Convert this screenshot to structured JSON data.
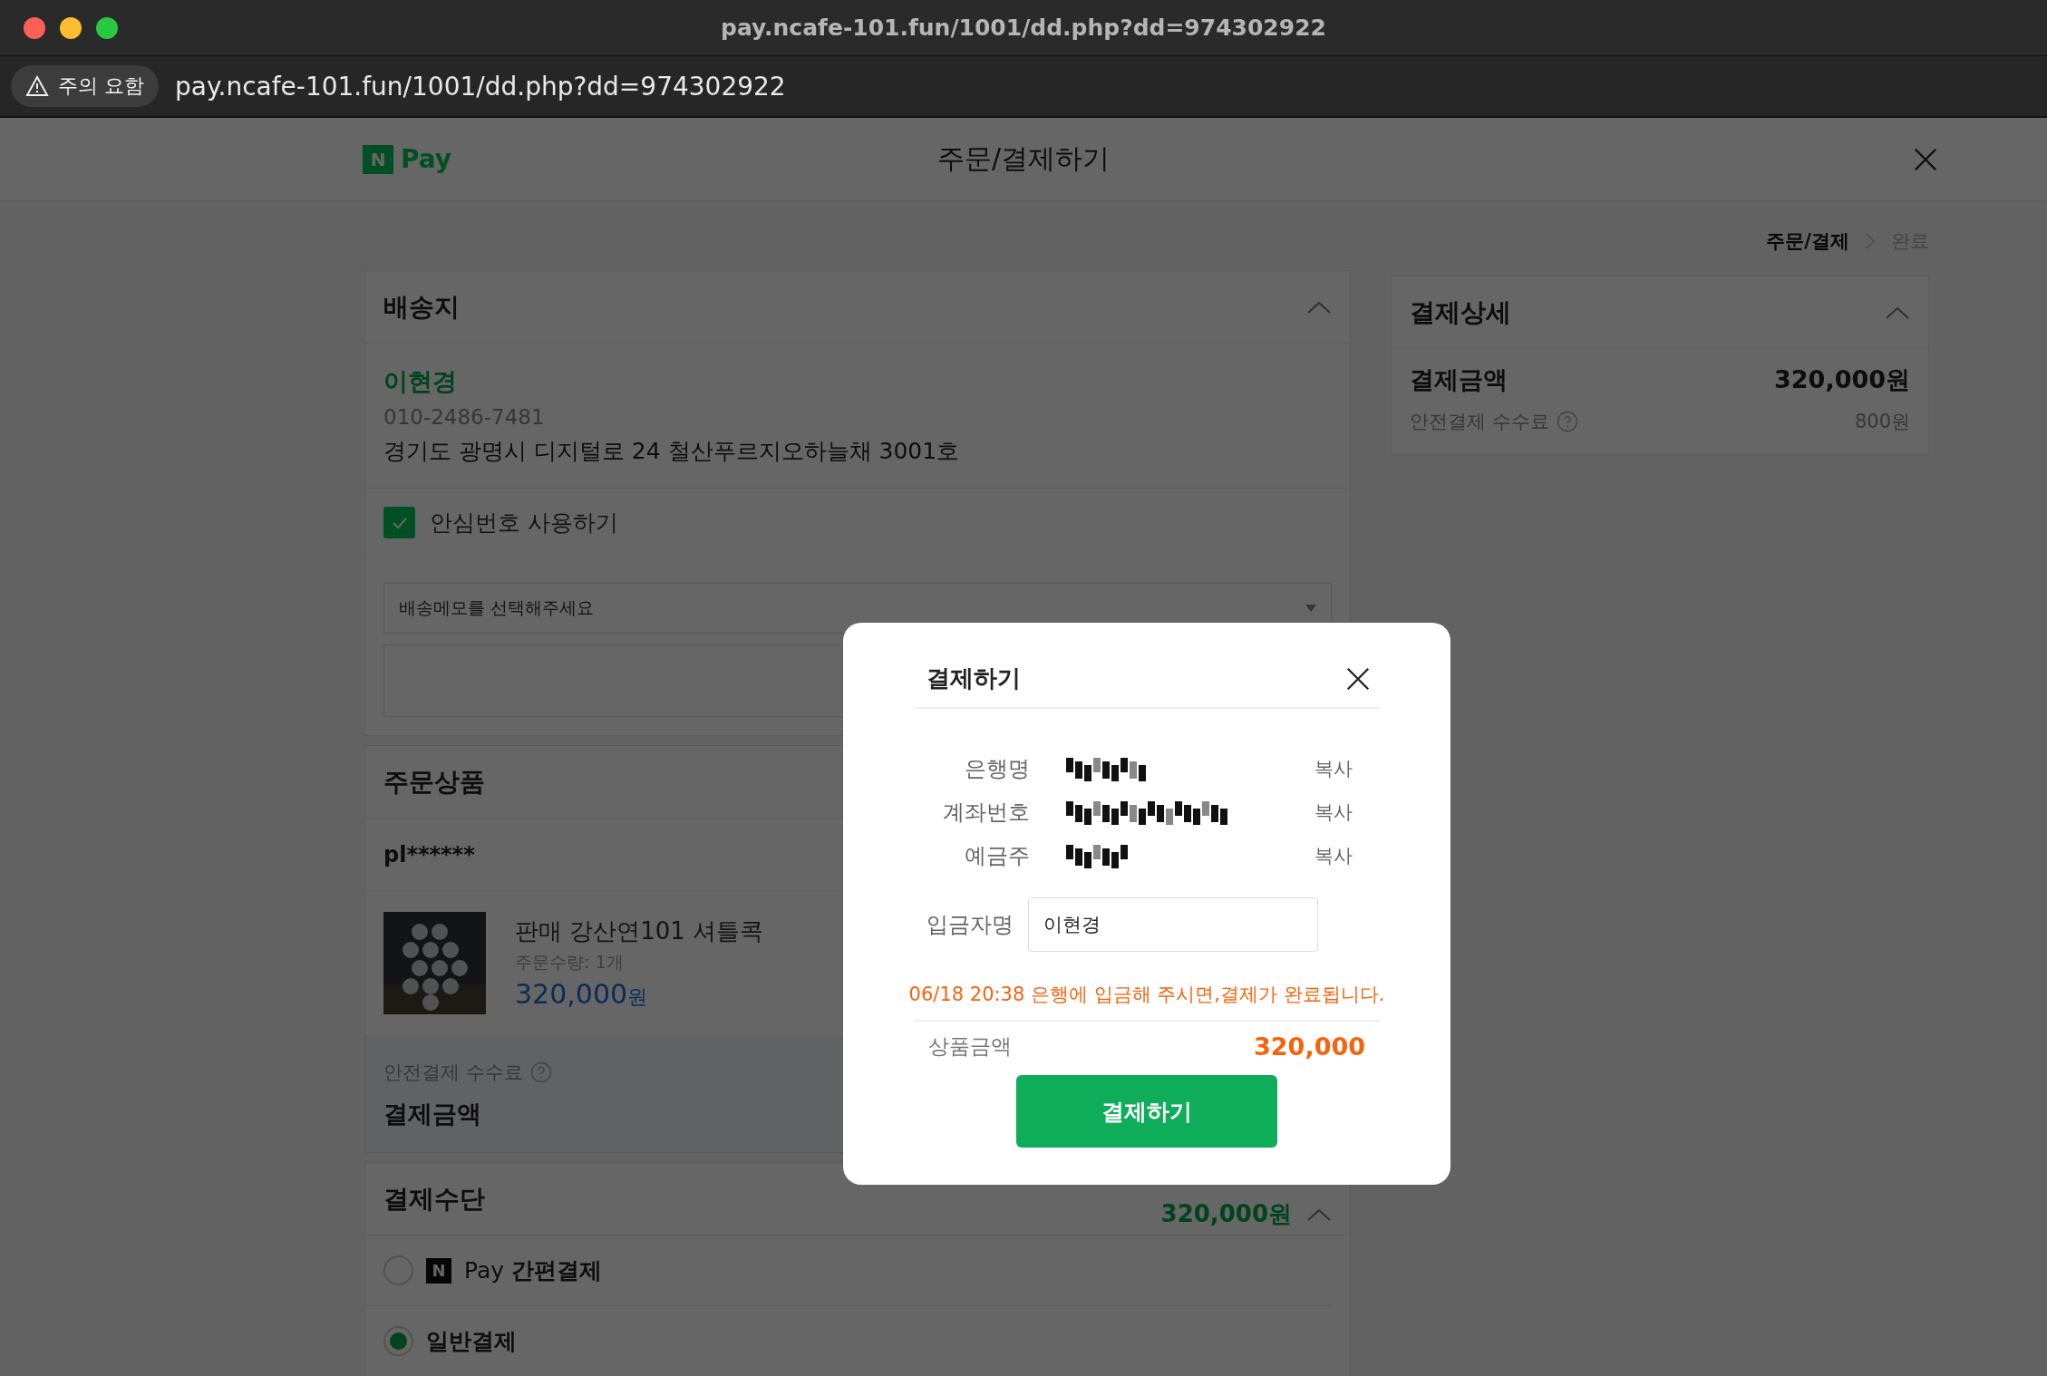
{
  "browser": {
    "title": "pay.ncafe-101.fun/1001/dd.php?dd=974302922",
    "warning": "주의 요함",
    "url": "pay.ncafe-101.fun/1001/dd.php?dd=974302922"
  },
  "header": {
    "logo_mark": "N",
    "logo_text": "Pay",
    "title": "주문/결제하기"
  },
  "breadcrumb": [
    {
      "label": "주문/결제",
      "selected": true
    },
    {
      "label": "완료",
      "selected": false
    }
  ],
  "shipping": {
    "title": "배송지",
    "expanded": true,
    "name": "이현경",
    "phone": "010-2486-7481",
    "address": "경기도 광명시 디지털로 24 철산푸르지오하늘채 3001호",
    "safe_number": {
      "label": "안심번호 사용하기",
      "checked": true
    },
    "memo": {
      "value": "배송메모를 선택해주세요"
    }
  },
  "order": {
    "title": "주문상품",
    "seller": "pl******",
    "product": {
      "name": "판매 강산연101 셔틀콕",
      "quantity": "주문수량: 1개",
      "price": "320,000",
      "unit": "원"
    },
    "fee_label": "안전결제 수수료",
    "total_label": "결제금액"
  },
  "payment_method": {
    "title": "결제수단",
    "amount": "320,000원",
    "expanded": true,
    "options": [
      {
        "kind": "npay",
        "mark": "N",
        "label": "Pay **간편결제**",
        "selected": false
      },
      {
        "kind": "plain",
        "label": "일반결제",
        "selected": true
      }
    ]
  },
  "details": {
    "title": "결제상세",
    "expanded": true,
    "total_label": "결제금액",
    "total": "320,000원",
    "fee_label": "안전결제 수수료",
    "fee": "800원"
  },
  "modal": {
    "title": "결제하기",
    "rows": [
      {
        "label": "은행명",
        "kind": "redacted",
        "copy": "복사"
      },
      {
        "label": "계좌번호",
        "kind": "redacted",
        "copy": "복사"
      },
      {
        "label": "예금주",
        "kind": "redacted",
        "copy": "복사"
      }
    ],
    "depositor": {
      "label": "입금자명",
      "value": "이현경"
    },
    "notice": "06/18 20:38 은행에 입금해 주시면,결제가 완료됩니다.",
    "amount_label": "상품금액",
    "amount": "320,000",
    "button": "결제하기"
  }
}
